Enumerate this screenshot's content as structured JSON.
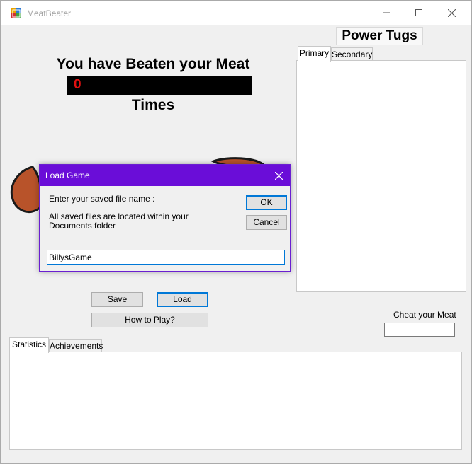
{
  "window": {
    "title": "MeatBeater",
    "controls": {
      "minimize": "minimize-icon",
      "maximize": "maximize-icon",
      "close": "close-icon"
    }
  },
  "header": {
    "power_tugs": "Power Tugs"
  },
  "power_tabs": [
    {
      "label": "Primary",
      "active": true
    },
    {
      "label": "Secondary",
      "active": false
    }
  ],
  "main": {
    "headline": "You have Beaten your Meat",
    "counter": "0",
    "times": "Times"
  },
  "buttons": {
    "save": "Save",
    "load": "Load",
    "how_to_play": "How to Play?"
  },
  "cheat": {
    "label": "Cheat your Meat",
    "value": ""
  },
  "stats_tabs": [
    {
      "label": "Statistics",
      "active": true
    },
    {
      "label": "Achievements",
      "active": false
    }
  ],
  "dialog": {
    "title": "Load Game",
    "prompt": "Enter your saved file name :",
    "note": "All saved files are located within your Documents folder",
    "ok": "OK",
    "cancel": "Cancel",
    "input_value": "BillysGame"
  },
  "colors": {
    "dialog_titlebar": "#6a0dd8",
    "counter_bg": "#000000",
    "counter_text": "#e01010",
    "focus_accent": "#0078d7"
  }
}
